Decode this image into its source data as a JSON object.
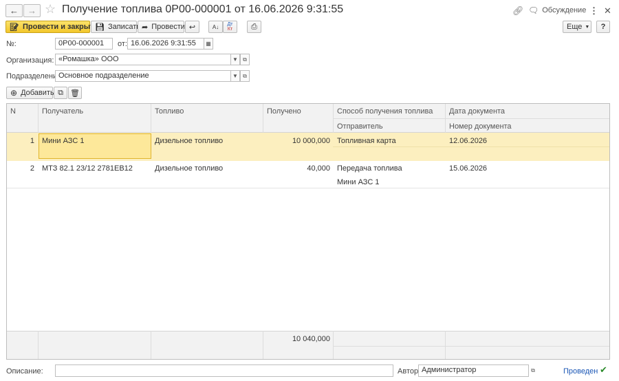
{
  "window": {
    "title": "Получение топлива 0Р00-000001 от 16.06.2026 9:31:55",
    "discussion_label": "Обсуждение"
  },
  "toolbar": {
    "post_close_label": "Провести и закрыть",
    "save_label": "Записать",
    "post_label": "Провести",
    "more_label": "Еще",
    "help_label": "?",
    "dt_kt_top": "Дт",
    "dt_kt_bottom": "Кт"
  },
  "form": {
    "number_label": "№:",
    "number_value": "0Р00-000001",
    "date_label": "от:",
    "date_value": "16.06.2026  9:31:55",
    "org_label": "Организация:",
    "org_value": "«Ромашка» ООО",
    "dept_label": "Подразделение:",
    "dept_value": "Основное подразделение"
  },
  "table_toolbar": {
    "add_label": "Добавить"
  },
  "table": {
    "headers": {
      "n": "N",
      "recipient": "Получатель",
      "fuel": "Топливо",
      "received": "Получено",
      "method": "Способ получения топлива",
      "sender": "Отправитель",
      "doc_date": "Дата документа",
      "doc_number": "Номер документа"
    },
    "rows": [
      {
        "n": "1",
        "recipient": "Мини АЗС 1",
        "fuel": "Дизельное топливо",
        "received": "10 000,000",
        "method": "Топливная карта",
        "sender": "",
        "doc_date": "12.06.2026",
        "doc_number": ""
      },
      {
        "n": "2",
        "recipient": "МТЗ 82.1 23/12 2781ЕВ12",
        "fuel": "Дизельное топливо",
        "received": "40,000",
        "method": "Передача топлива",
        "sender": "Мини АЗС 1",
        "doc_date": "15.06.2026",
        "doc_number": ""
      }
    ],
    "total_received": "10 040,000"
  },
  "bottom": {
    "description_label": "Описание:",
    "description_value": "",
    "author_label": "Автор:",
    "author_value": "Администратор",
    "status": "Проведен"
  },
  "colors": {
    "primary_button": "#f3c72b",
    "selected_row": "#fcefbf",
    "status_link": "#1a56b5",
    "status_check": "#2a8a2a"
  }
}
